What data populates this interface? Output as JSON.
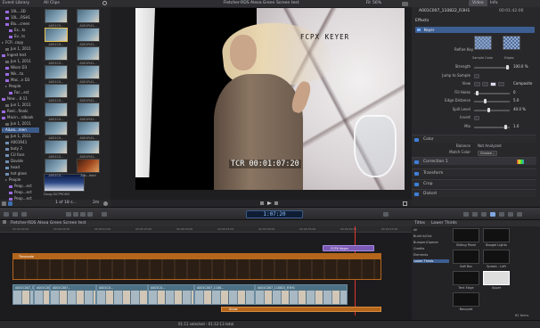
{
  "event_library": {
    "header": "Event Library",
    "items": [
      {
        "label": "10L...3D",
        "indent": 1,
        "type": "event"
      },
      {
        "label": "10L...RSH1",
        "indent": 1,
        "type": "event"
      },
      {
        "label": "Blu...creen",
        "indent": 1,
        "type": "event"
      },
      {
        "label": "Ex...ts",
        "indent": 2,
        "type": "event"
      },
      {
        "label": "Ev...ts",
        "indent": 2,
        "type": "event"
      },
      {
        "label": "FCP...copy",
        "indent": 0,
        "type": "folder"
      },
      {
        "label": "Jun 1, 2011",
        "indent": 1,
        "type": "date"
      },
      {
        "label": "Ingest test",
        "indent": 0,
        "type": "event"
      },
      {
        "label": "Jun 1, 2011",
        "indent": 1,
        "type": "date"
      },
      {
        "label": "Nikon D3",
        "indent": 1,
        "type": "event"
      },
      {
        "label": "Nik...ta",
        "indent": 1,
        "type": "event"
      },
      {
        "label": "Mac...n D3",
        "indent": 1,
        "type": "event"
      },
      {
        "label": "People",
        "indent": 1,
        "type": "folder"
      },
      {
        "label": "Fac...ect",
        "indent": 2,
        "type": "event"
      },
      {
        "label": "New ...0-11",
        "indent": 0,
        "type": "event"
      },
      {
        "label": "Jun 1, 2011",
        "indent": 1,
        "type": "date"
      },
      {
        "label": "Reel...finals",
        "indent": 0,
        "type": "event"
      },
      {
        "label": "Macin...rdbook",
        "indent": 0,
        "type": "event"
      },
      {
        "label": "Jun 1, 2011",
        "indent": 1,
        "type": "date"
      },
      {
        "label": "AiLea...reen",
        "indent": 0,
        "type": "folder",
        "selected": true
      },
      {
        "label": "Jun 1, 2011",
        "indent": 1,
        "type": "date"
      },
      {
        "label": "A001R41",
        "indent": 1,
        "type": "keyword"
      },
      {
        "label": "buty 3",
        "indent": 1,
        "type": "keyword"
      },
      {
        "label": "CU face",
        "indent": 1,
        "type": "keyword"
      },
      {
        "label": "Davide",
        "indent": 1,
        "type": "keyword"
      },
      {
        "label": "head",
        "indent": 1,
        "type": "keyword"
      },
      {
        "label": "hot glass",
        "indent": 1,
        "type": "keyword"
      },
      {
        "label": "People",
        "indent": 1,
        "type": "folder"
      },
      {
        "label": "Peop...ect",
        "indent": 2,
        "type": "event"
      },
      {
        "label": "Peop...ect",
        "indent": 2,
        "type": "event"
      },
      {
        "label": "Peop...ect",
        "indent": 2,
        "type": "event"
      }
    ]
  },
  "browser": {
    "filter": "All Clips",
    "clips": [
      {
        "label": "A001C0...",
        "selected": false
      },
      {
        "label": "A001R41...",
        "selected": false
      },
      {
        "label": "A001C0...",
        "selected": true
      },
      {
        "label": "A001R41...",
        "selected": false
      },
      {
        "label": "A001C0...",
        "selected": false
      },
      {
        "label": "A001R41...",
        "selected": false
      },
      {
        "label": "A001C0...",
        "selected": false
      },
      {
        "label": "A001R41...",
        "selected": false
      },
      {
        "label": "A001C0...",
        "selected": false
      },
      {
        "label": "A001R41...",
        "selected": false
      },
      {
        "label": "A001C0...",
        "selected": false
      },
      {
        "label": "A001R41...",
        "selected": false
      },
      {
        "label": "A001C0...",
        "selected": false
      },
      {
        "label": "A001R41...",
        "selected": false
      },
      {
        "label": "A001C0...",
        "selected": false
      },
      {
        "label": "A001R41...",
        "selected": false
      },
      {
        "label": "A001C0...",
        "selected": false
      },
      {
        "label": "Aos...lead",
        "selected": false
      }
    ],
    "bottom_clip": "Doug DiCPROHD",
    "status": "1 of 18 s...",
    "duration": "2m"
  },
  "viewer": {
    "title": "Fletcher-RDS Alexa Green Screen test",
    "fit": "Fit",
    "zoom_value": "56%",
    "overlay_text": "FCPX KEYER",
    "timecode_burn": "TCR 00:01:07:20"
  },
  "inspector": {
    "tabs": [
      "Video",
      "Info"
    ],
    "active_tab": "Video",
    "clip_name": "A001C007_110822_R3H1",
    "duration": "00:01:42:06",
    "effects_header": "Effects",
    "keyer_name": "Keyer",
    "refine_key": "Refine Key",
    "sample_color": "Sample Color",
    "edges": "Edges",
    "params": [
      {
        "label": "Strength",
        "value": "100.0 %",
        "fraction": 0.95
      },
      {
        "label": "Jump to Sample",
        "value": "",
        "fraction": null
      },
      {
        "label": "View",
        "value": "Composite",
        "fraction": null
      },
      {
        "label": "Fill Holes",
        "value": "0",
        "fraction": 0.05
      },
      {
        "label": "Edge Distance",
        "value": "5.0",
        "fraction": 0.3
      },
      {
        "label": "Spill Level",
        "value": "40.0 %",
        "fraction": 0.4
      },
      {
        "label": "Invert",
        "value": "",
        "fraction": null
      },
      {
        "label": "Mix",
        "value": "1.0",
        "fraction": 0.9
      }
    ],
    "color_section": "Color",
    "balance_label": "Balance",
    "balance_value": "Not Analyzed",
    "match_color_label": "Match Color",
    "match_color_button": "Choose...",
    "sections": [
      "Correction 1",
      "Transform",
      "Crop",
      "Distort"
    ]
  },
  "toolbar": {
    "timecode": "1:07:20"
  },
  "timeline": {
    "title": "Fletcher-RDS Alexa Green Screen test",
    "ruler": [
      "00:00:00:00",
      "00:00:05:00",
      "00:00:10:00",
      "00:00:15:00",
      "00:00:20:00",
      "00:00:25:00",
      "00:00:30:00",
      "00:00:35:00",
      "00:00:40:00",
      "00:00:45:00"
    ],
    "title_clip": "FCPX Keyer",
    "timecode_clip": "Timecode",
    "primary_clips": [
      "A001C007_110822_R3H1",
      "A001C007_110822_R3H1",
      "A001C007...",
      "A001C0...",
      "A001C0...",
      "A001C007_1108...",
      "A001C007_110822_R3H1"
    ],
    "snow_clip": "Snow",
    "status": "01:11 selected - 01:12:13 total"
  },
  "titles_browser": {
    "header": "Titles",
    "search_label": "Lower Thirds",
    "categories": [
      "All",
      "Build In/Out",
      "Bumper/Opener",
      "Credits",
      "Elements",
      "Lower Thirds"
    ],
    "selected_category": "Lower Thirds",
    "subheaders": [
      "Build In/Out",
      "Bumper/Opener",
      "Credits",
      "Elements"
    ],
    "items": [
      {
        "label": "Sliding Panel"
      },
      {
        "label": "Boogie Lights"
      },
      {
        "label": "Soft Bar"
      },
      {
        "label": "Splash - Left"
      },
      {
        "label": "Tent Edge"
      },
      {
        "label": "Upper"
      },
      {
        "label": "Bouquet"
      }
    ],
    "count": "82 items"
  }
}
